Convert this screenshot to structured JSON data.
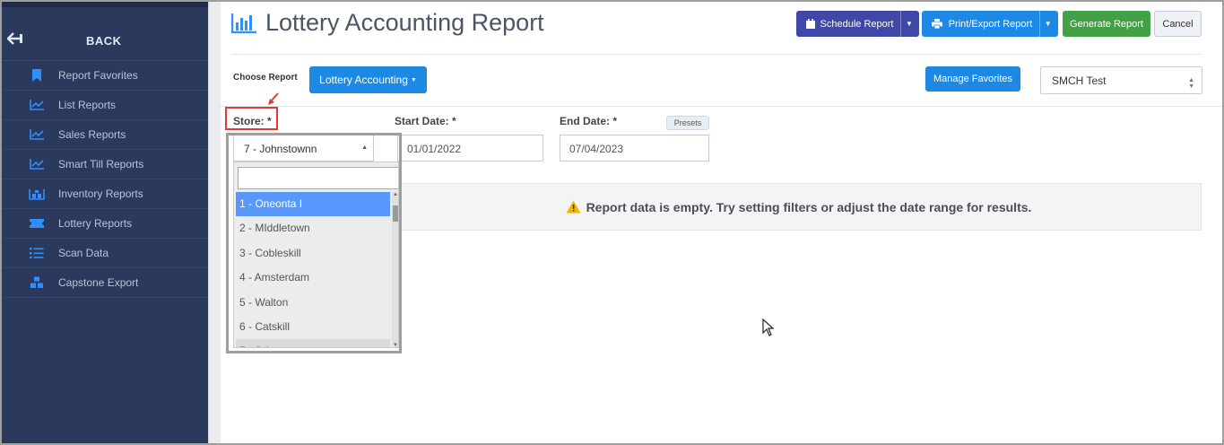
{
  "sidebar": {
    "back_label": "BACK",
    "items": [
      {
        "label": "Report Favorites",
        "icon": "bookmark-icon"
      },
      {
        "label": "List Reports",
        "icon": "line-chart-icon"
      },
      {
        "label": "Sales Reports",
        "icon": "line-chart-icon"
      },
      {
        "label": "Smart Till Reports",
        "icon": "line-chart-icon"
      },
      {
        "label": "Inventory Reports",
        "icon": "warehouse-icon"
      },
      {
        "label": "Lottery Reports",
        "icon": "ticket-icon"
      },
      {
        "label": "Scan Data",
        "icon": "list-icon"
      },
      {
        "label": "Capstone Export",
        "icon": "cubes-icon"
      }
    ]
  },
  "header": {
    "title": "Lottery Accounting Report",
    "schedule_label": "Schedule Report",
    "print_label": "Print/Export Report",
    "generate_label": "Generate Report",
    "cancel_label": "Cancel"
  },
  "choose": {
    "label": "Choose Report",
    "report_button": "Lottery Accounting",
    "manage_favorites": "Manage Favorites",
    "favorite_selected": "SMCH Test"
  },
  "filters": {
    "store_label": "Store: *",
    "store_value": "7 - Johnstownn",
    "start_label": "Start Date: *",
    "start_value": "01/01/2022",
    "end_label": "End Date: *",
    "end_value": "07/04/2023",
    "presets_label": "Presets"
  },
  "store_options": [
    "1 - Oneonta I",
    "2 - MIddletown",
    "3 - Cobleskill",
    "4 - Amsterdam",
    "5 - Walton",
    "6 - Catskill",
    "7 - Johnstownn"
  ],
  "empty_message": "Report data is empty. Try setting filters or adjust the date range for results.",
  "colors": {
    "sidebar_bg": "#2b3a5c",
    "primary": "#1e88e5",
    "schedule": "#3f48a7",
    "generate": "#43a047",
    "selected_option": "#5897fb",
    "highlight_red": "#e53935"
  }
}
